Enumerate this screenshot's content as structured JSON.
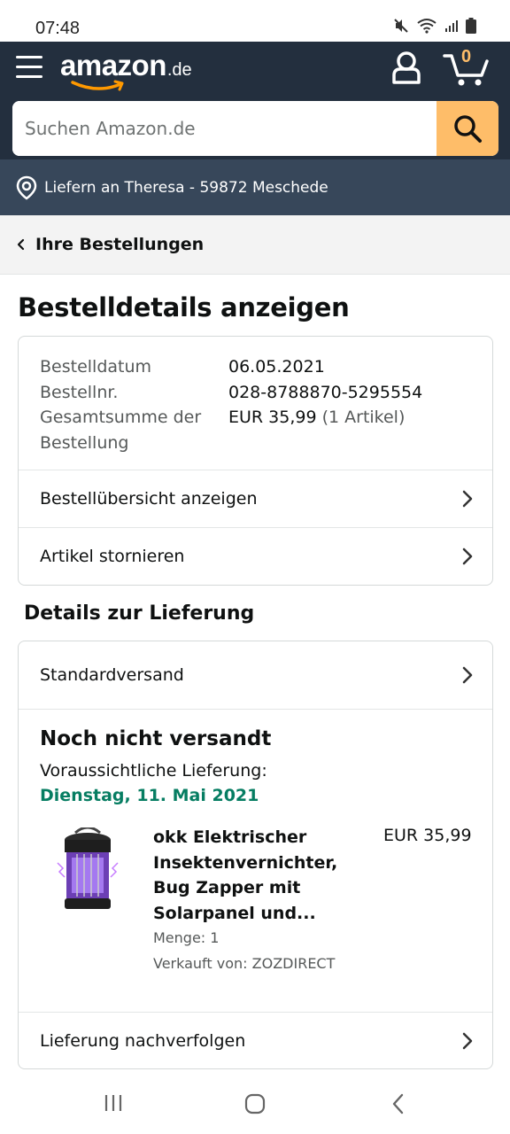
{
  "status_bar": {
    "time": "07:48"
  },
  "header": {
    "logo_text": "amazon",
    "logo_tld": ".de",
    "cart_count": "0",
    "search": {
      "placeholder": "Suchen Amazon.de",
      "value": ""
    }
  },
  "location": {
    "text": "Liefern an Theresa - 59872 Meschede"
  },
  "breadcrumb": {
    "label": "Ihre Bestellungen"
  },
  "page_title": "Bestelldetails anzeigen",
  "order": {
    "rows": [
      {
        "key": "Bestelldatum",
        "value": "06.05.2021",
        "extra": ""
      },
      {
        "key": "Bestellnr.",
        "value": "028-8788870-5295554",
        "extra": ""
      },
      {
        "key": "Gesamtsumme der Bestellung",
        "value": "EUR 35,99",
        "extra": "(1 Artikel)"
      }
    ],
    "links": {
      "summary": "Bestellübersicht anzeigen",
      "cancel": "Artikel stornieren"
    }
  },
  "delivery": {
    "section_title": "Details zur Lieferung",
    "shipping_method": "Standardversand",
    "status": "Noch nicht versandt",
    "eta_label": "Voraussichtliche Lieferung:",
    "eta_date": "Dienstag, 11. Mai 2021",
    "product": {
      "title": "okk Elektrischer Insektenvernichter, Bug Zapper mit Solarpanel und...",
      "price": "EUR 35,99",
      "quantity": "Menge: 1",
      "seller": "Verkauft von: ZOZDIRECT"
    },
    "track_label": "Lieferung nachverfolgen"
  },
  "colors": {
    "nav_bg": "#232f3e",
    "location_bg": "#37475a",
    "search_button": "#febd69",
    "eta_green": "#067d62"
  }
}
